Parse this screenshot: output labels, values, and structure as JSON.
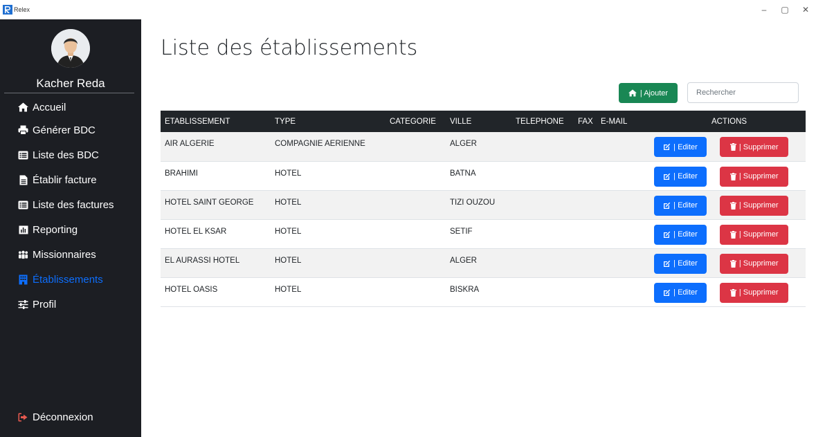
{
  "window": {
    "title": "Relex",
    "minimize": "–",
    "maximize": "▢",
    "close": "✕"
  },
  "sidebar": {
    "user_name": "Kacher Reda",
    "items": [
      {
        "label": "Accueil",
        "icon": "home-icon",
        "active": false
      },
      {
        "label": "Générer BDC",
        "icon": "print-icon",
        "active": false
      },
      {
        "label": "Liste des BDC",
        "icon": "list-icon",
        "active": false
      },
      {
        "label": "Établir facture",
        "icon": "file-icon",
        "active": false
      },
      {
        "label": "Liste des factures",
        "icon": "list-icon",
        "active": false
      },
      {
        "label": "Reporting",
        "icon": "chart-icon",
        "active": false
      },
      {
        "label": "Missionnaires",
        "icon": "people-icon",
        "active": false
      },
      {
        "label": "Établissements",
        "icon": "building-icon",
        "active": true
      },
      {
        "label": "Profil",
        "icon": "sliders-icon",
        "active": false
      }
    ],
    "logout_label": "Déconnexion"
  },
  "main": {
    "title": "Liste des établissements",
    "add_label": "| Ajouter",
    "search_placeholder": "Rechercher",
    "columns": [
      "ETABLISSEMENT",
      "TYPE",
      "CATEGORIE",
      "VILLE",
      "TELEPHONE",
      "FAX",
      "E-MAIL",
      "ACTIONS"
    ],
    "edit_label": "| Editer",
    "delete_label": "| Supprimer",
    "rows": [
      {
        "etablissement": "AIR ALGERIE",
        "type": "COMPAGNIE AERIENNE",
        "categorie": "",
        "ville": "ALGER",
        "telephone": "",
        "fax": "",
        "email": ""
      },
      {
        "etablissement": "BRAHIMI",
        "type": "HOTEL",
        "categorie": "",
        "ville": "BATNA",
        "telephone": "",
        "fax": "",
        "email": ""
      },
      {
        "etablissement": "HOTEL SAINT GEORGE",
        "type": "HOTEL",
        "categorie": "",
        "ville": "TIZI OUZOU",
        "telephone": "",
        "fax": "",
        "email": ""
      },
      {
        "etablissement": "HOTEL EL KSAR",
        "type": "HOTEL",
        "categorie": "",
        "ville": "SETIF",
        "telephone": "",
        "fax": "",
        "email": ""
      },
      {
        "etablissement": "EL AURASSI HOTEL",
        "type": "HOTEL",
        "categorie": "",
        "ville": "ALGER",
        "telephone": "",
        "fax": "",
        "email": ""
      },
      {
        "etablissement": "HOTEL OASIS",
        "type": "HOTEL",
        "categorie": "",
        "ville": "BISKRA",
        "telephone": "",
        "fax": "",
        "email": ""
      }
    ]
  },
  "colors": {
    "sidebar_bg": "#1c1e23",
    "active": "#0d6efd",
    "add": "#198754",
    "edit": "#0d6efd",
    "delete": "#dc3545",
    "table_head": "#212529"
  }
}
